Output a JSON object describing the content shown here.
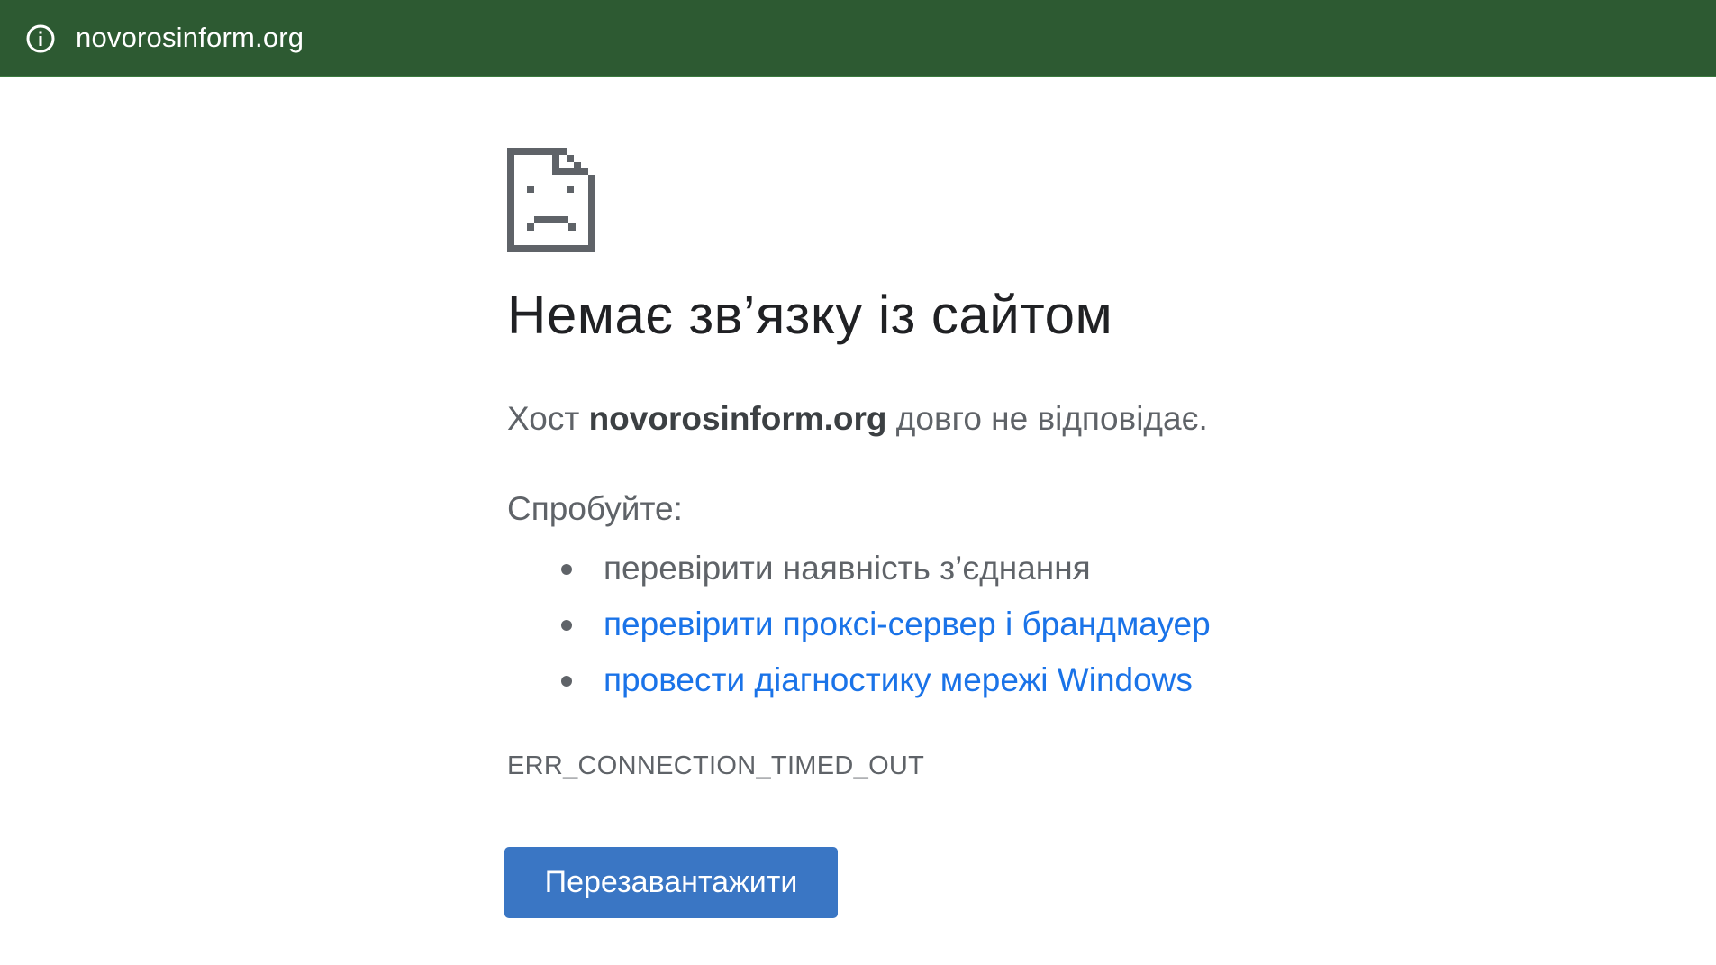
{
  "addressbar": {
    "icon": "info-icon",
    "url": "novorosinform.org"
  },
  "error_page": {
    "icon": "sad-document-icon",
    "title": "Немає зв’язку із сайтом",
    "summary": {
      "prefix": "Хост ",
      "host": "novorosinform.org",
      "suffix": " довго не відповідає."
    },
    "try_label": "Спробуйте:",
    "suggestions": [
      {
        "text": "перевірити наявність з’єднання",
        "is_link": false
      },
      {
        "text": "перевірити проксі-сервер і брандмауер",
        "is_link": true
      },
      {
        "text": "провести діагностику мережі Windows",
        "is_link": true
      }
    ],
    "error_code": "ERR_CONNECTION_TIMED_OUT",
    "reload_label": "Перезавантажити"
  },
  "colors": {
    "addressbar_bg": "#2d5a32",
    "link": "#1a73e8",
    "button": "#3a76c4",
    "text_secondary": "#5f6368",
    "title": "#202124"
  }
}
